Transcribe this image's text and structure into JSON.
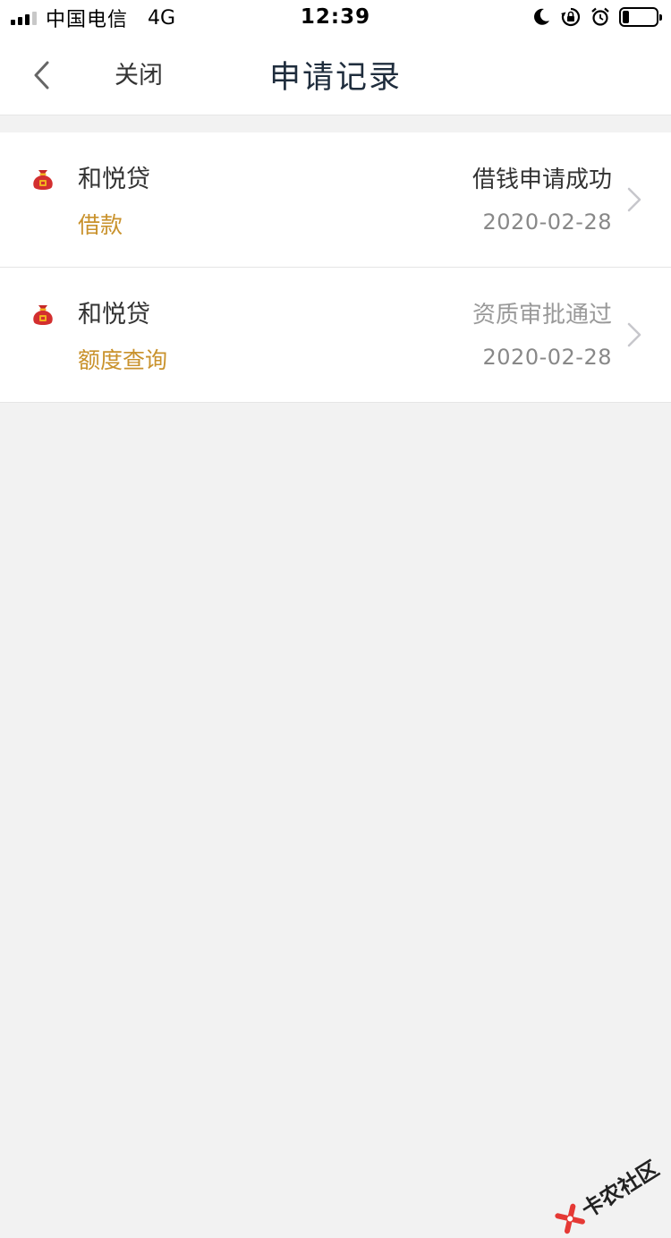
{
  "status_bar": {
    "carrier": "中国电信",
    "network": "4G",
    "time": "12:39",
    "icons": [
      "signal-icon",
      "moon-icon",
      "rotation-lock-icon",
      "alarm-icon",
      "battery-icon"
    ],
    "battery_level": 0.2
  },
  "nav": {
    "back_icon": "chevron-left-icon",
    "close_label": "关闭",
    "title": "申请记录"
  },
  "records": [
    {
      "icon": "money-bag-icon",
      "name": "和悦贷",
      "type": "借款",
      "status": "借钱申请成功",
      "date": "2020-02-28",
      "status_color": "#333333"
    },
    {
      "icon": "money-bag-icon",
      "name": "和悦贷",
      "type": "额度查询",
      "status": "资质审批通过",
      "date": "2020-02-28",
      "status_color": "#999999"
    }
  ],
  "watermark": {
    "text": "卡农社区",
    "icon": "kanong-logo-icon"
  },
  "colors": {
    "accent_gold": "#c9922c",
    "title_dark": "#1f2d3d",
    "background": "#f2f2f2"
  }
}
